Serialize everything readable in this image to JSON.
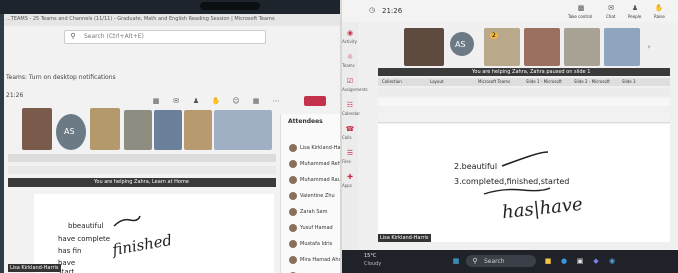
{
  "left": {
    "window_title": "...TEAMS - 25 Teams and Channels (11/11) - Graduate, Math and English Reading Session | Microsoft Teams",
    "search_placeholder": "Search (Ctrl+Alt+E)",
    "notification": "Teams: Turn on desktop notifications",
    "timer": "21:26",
    "avatar_initials": "AS",
    "banner": "You are helping Zahra, Learn at Home",
    "people_header": "Attendees",
    "people": [
      "Lisa Kirkland-Harris",
      "Muhammad Rehman",
      "Muhammad Rauf Ahmed",
      "Valentine Zhu",
      "Zarah Sam",
      "Yusuf Hamad",
      "Mustafa Idris",
      "Mira Hamad Ahmad",
      "Adriana Burleson"
    ],
    "doc_lines": [
      "bbeautiful",
      "have complete",
      "has fin",
      "have",
      "start"
    ],
    "handwriting": "finished",
    "tooltip": "Lisa Kirkland-Harris"
  },
  "right": {
    "timer": "21:26",
    "top_buttons": [
      "Take control",
      "Chat",
      "People",
      "Raise"
    ],
    "sidebar": [
      "Activity",
      "Teams",
      "Assignments",
      "Calendar",
      "Calls",
      "Files",
      "Apps"
    ],
    "avatar_initials": "AS",
    "counter": "2",
    "banner": "You are helping Zahra, Zahra paused on slide 1",
    "tabs": [
      "Collection",
      "Layout",
      "Microsoft Teams",
      "Slide 1 - Microsoft",
      "Slide 2 - Microsoft",
      "Slide 3"
    ],
    "doc_lines": [
      "2.beautiful",
      "3.completed,finished,started"
    ],
    "handwriting": "has|have",
    "weather_temp": "15°C",
    "weather_text": "Cloudy",
    "taskbar_search": "Search",
    "tooltip": "Lisa Kirkland-Harris"
  }
}
